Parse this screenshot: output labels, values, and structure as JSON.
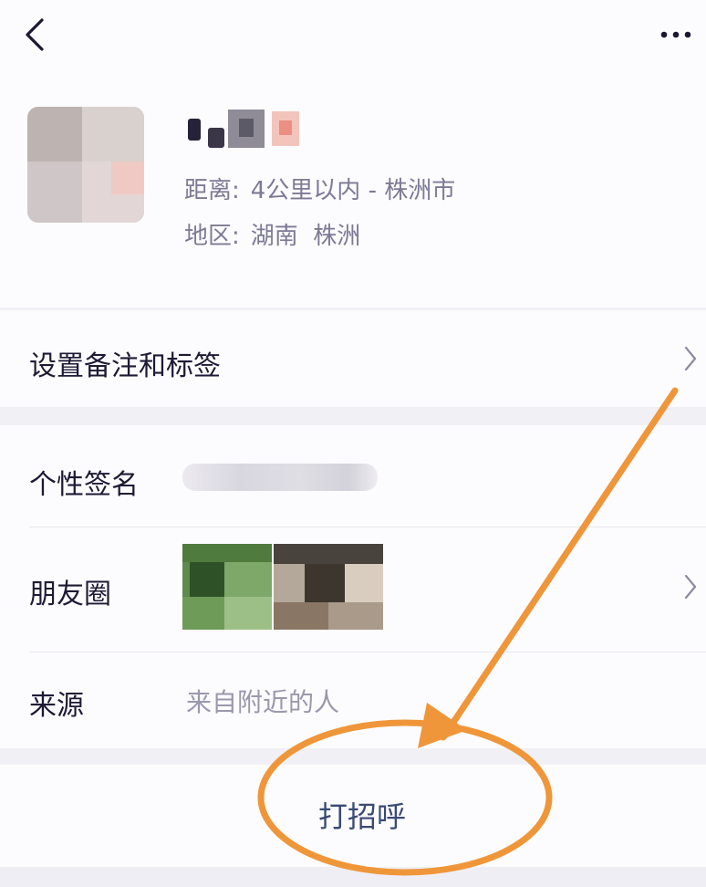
{
  "profile": {
    "distance_label": "距离:",
    "distance_value": "4公里以内 - 株洲市",
    "region_label": "地区:",
    "region_value": "湖南  株洲"
  },
  "menu": {
    "remark_tags": "设置备注和标签",
    "signature": "个性签名",
    "moments": "朋友圈",
    "source": "来源",
    "source_value": "来自附近的人"
  },
  "actions": {
    "greet": "打招呼"
  },
  "colors": {
    "background": "#f1f0f5",
    "card": "#fcfcfe",
    "annotation": "#f0963a",
    "greet_text": "#3a4a75"
  }
}
